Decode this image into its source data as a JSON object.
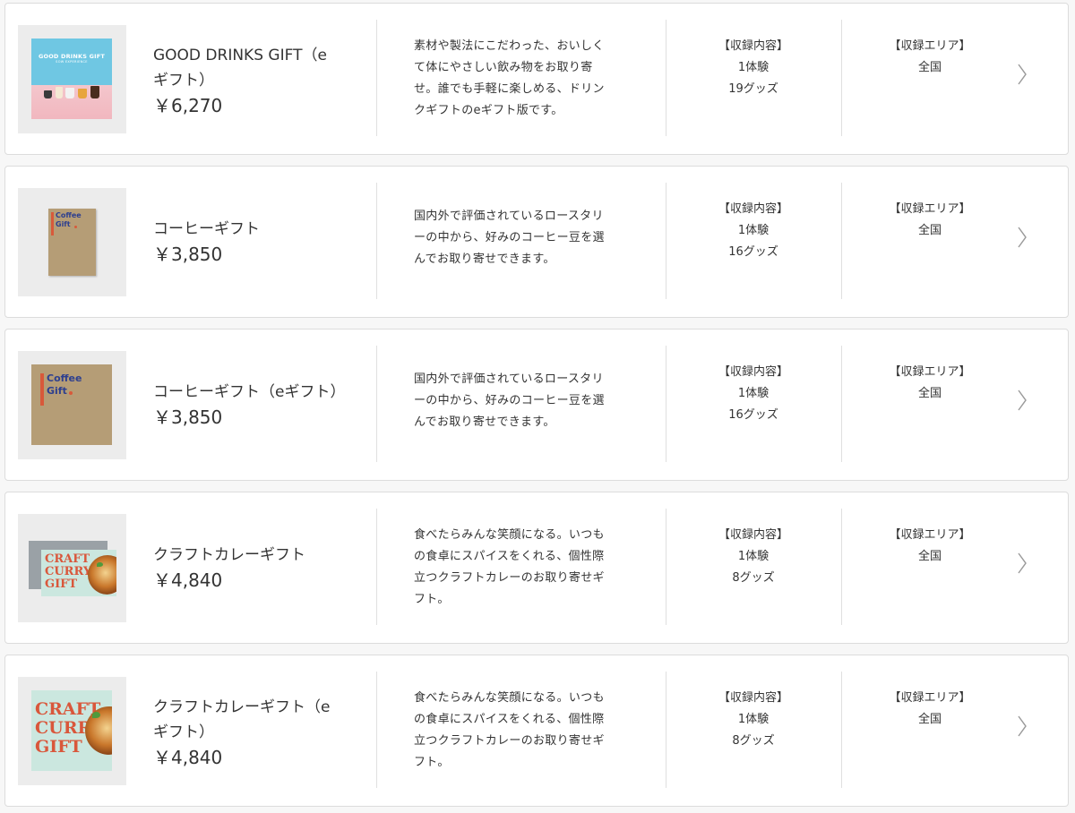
{
  "products": [
    {
      "name": "GOOD DRINKS GIFT（e ギフト）",
      "name_lines": [
        "GOOD DRINKS GIFT（e",
        "ギフト）"
      ],
      "price": "￥6,270",
      "description_lines": [
        "素材や製法にこだわった、おいしく",
        "て体にやさしい飲み物をお取り寄",
        "せ。誰でも手軽に楽しめる、ドリン",
        "クギフトのeギフト版です。"
      ],
      "contents_label": "【収録内容】",
      "contents_lines": [
        "1体験",
        "19グッズ"
      ],
      "area_label": "【収録エリア】",
      "area_value": "全国",
      "image_title": "GOOD DRINKS GIFT",
      "image_subtitle": "SOW EXPERIENCE"
    },
    {
      "name": "コーヒーギフト",
      "name_lines": [
        "コーヒーギフト"
      ],
      "price": "￥3,850",
      "description_lines": [
        "国内外で評価されているロースタリ",
        "ーの中から、好みのコーヒー豆を選",
        "んでお取り寄せできます。"
      ],
      "contents_label": "【収録内容】",
      "contents_lines": [
        "1体験",
        "16グッズ"
      ],
      "area_label": "【収録エリア】",
      "area_value": "全国",
      "image_title_1": "Coffee",
      "image_title_2": "Gift"
    },
    {
      "name": "コーヒーギフト（eギフト）",
      "name_lines": [
        "コーヒーギフト（eギフト）"
      ],
      "price": "￥3,850",
      "description_lines": [
        "国内外で評価されているロースタリ",
        "ーの中から、好みのコーヒー豆を選",
        "んでお取り寄せできます。"
      ],
      "contents_label": "【収録内容】",
      "contents_lines": [
        "1体験",
        "16グッズ"
      ],
      "area_label": "【収録エリア】",
      "area_value": "全国",
      "image_title_1": "Coffee",
      "image_title_2": "Gift"
    },
    {
      "name": "クラフトカレーギフト",
      "name_lines": [
        "クラフトカレーギフト"
      ],
      "price": "￥4,840",
      "description_lines": [
        "食べたらみんな笑顔になる。いつも",
        "の食卓にスパイスをくれる、個性際",
        "立つクラフトカレーのお取り寄せギ",
        "フト。"
      ],
      "contents_label": "【収録内容】",
      "contents_lines": [
        "1体験",
        "8グッズ"
      ],
      "area_label": "【収録エリア】",
      "area_value": "全国",
      "image_words": [
        "CRAFT",
        "CURRY",
        "GIFT"
      ]
    },
    {
      "name": "クラフトカレーギフト（e ギフト）",
      "name_lines": [
        "クラフトカレーギフト（e",
        "ギフト）"
      ],
      "price": "￥4,840",
      "description_lines": [
        "食べたらみんな笑顔になる。いつも",
        "の食卓にスパイスをくれる、個性際",
        "立つクラフトカレーのお取り寄せギ",
        "フト。"
      ],
      "contents_label": "【収録内容】",
      "contents_lines": [
        "1体験",
        "8グッズ"
      ],
      "area_label": "【収録エリア】",
      "area_value": "全国",
      "image_words": [
        "CRAFT",
        "CURRY",
        "GIFT"
      ]
    }
  ],
  "icons": {
    "chevron": "chevron-right-icon"
  },
  "colors": {
    "card_border": "#dcdcdc",
    "text": "#333333",
    "chevron": "#9a9a9a",
    "accent_curry": "#d9573b",
    "accent_coffee": "#2d3f8f"
  }
}
